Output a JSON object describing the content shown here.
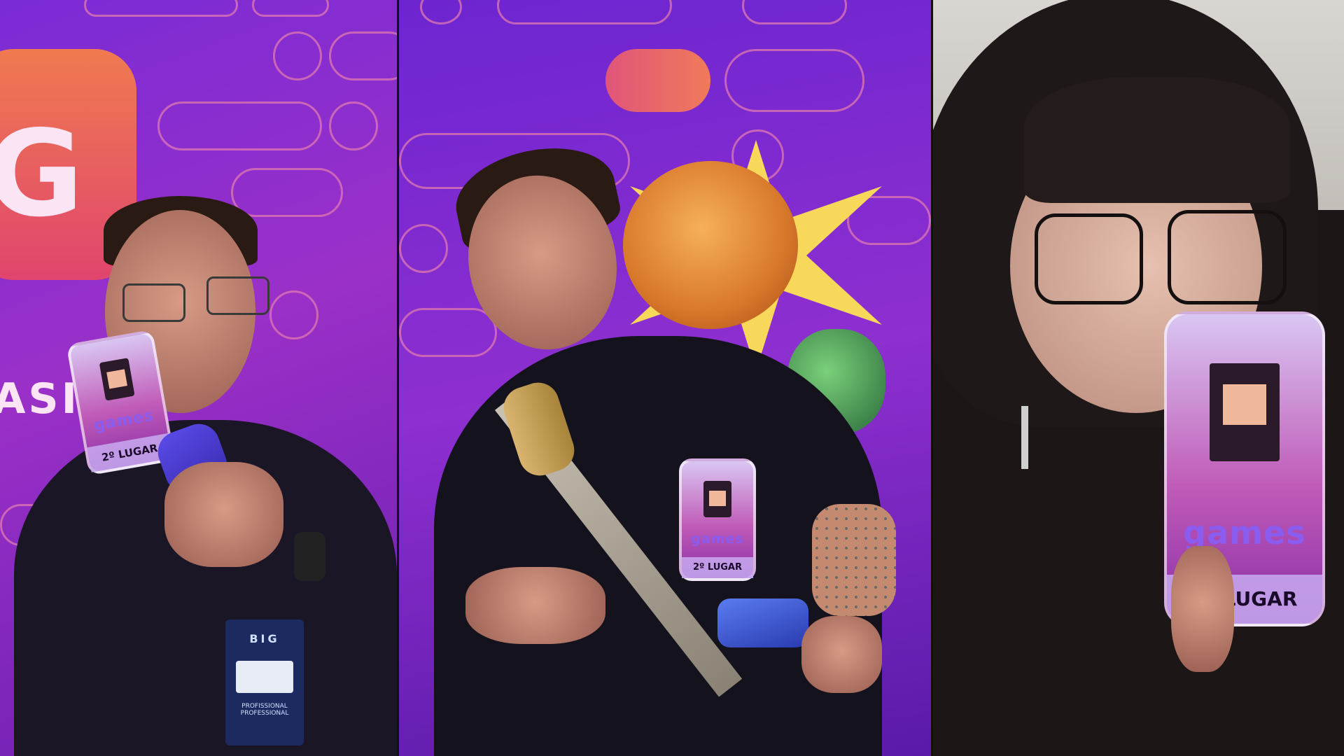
{
  "collage": {
    "panels": [
      {
        "id": "panel-left",
        "logo_letter": "G",
        "logo_partial_text": "ASIL",
        "trophy": {
          "brand": "games",
          "place": "2º LUGAR"
        },
        "badge": {
          "logo": "BIG",
          "line1": "PROFISSIONAL",
          "line2": "PROFESSIONAL"
        }
      },
      {
        "id": "panel-middle",
        "trophy": {
          "brand": "games",
          "place": "2º LUGAR"
        }
      },
      {
        "id": "panel-right",
        "trophy": {
          "brand": "games",
          "place": "2º LUGAR"
        }
      }
    ]
  },
  "colors": {
    "backdrop_purple": "#7a2bd6",
    "accent_pink": "#e07ab0",
    "logo_orange": "#f07a50",
    "trophy_magenta": "#c05cb8"
  }
}
